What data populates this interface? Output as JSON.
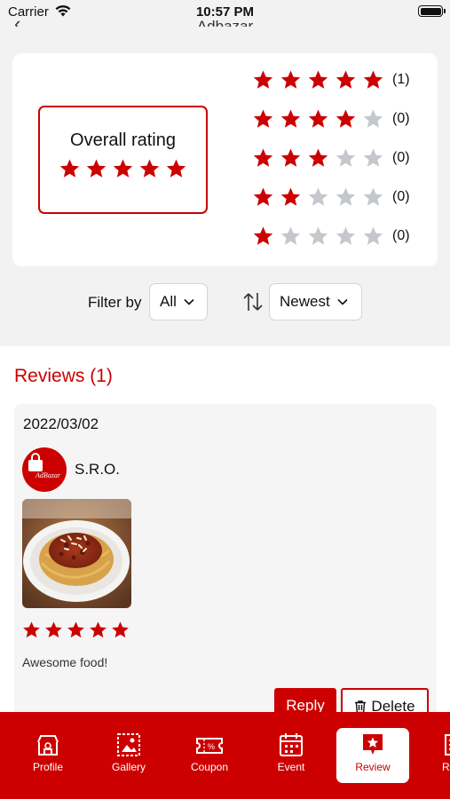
{
  "status_bar": {
    "carrier": "Carrier",
    "time": "10:57 PM"
  },
  "nav": {
    "title": "Adbazar",
    "back_icon": "chevron-left-icon"
  },
  "colors": {
    "accent": "#cc0000",
    "star_empty": "#c4c7cc",
    "background": "#f2f2f2"
  },
  "rating_summary": {
    "overall_label": "Overall rating",
    "overall_stars": 5,
    "breakdown": [
      {
        "stars": 5,
        "count": "(1)"
      },
      {
        "stars": 4,
        "count": "(0)"
      },
      {
        "stars": 3,
        "count": "(0)"
      },
      {
        "stars": 2,
        "count": "(0)"
      },
      {
        "stars": 1,
        "count": "(0)"
      }
    ]
  },
  "filter": {
    "label": "Filter by",
    "selected": "All",
    "sort_icon": "sort-arrows-icon",
    "sort_selected": "Newest"
  },
  "reviews": {
    "title": "Reviews (1)",
    "items": [
      {
        "date": "2022/03/02",
        "reviewer": "S.R.O.",
        "avatar_text": "AdBazar",
        "photo": "spaghetti-bolognese-photo",
        "stars": 5,
        "text": "Awesome food!",
        "reply_label": "Reply",
        "delete_label": "Delete"
      }
    ]
  },
  "tabs": [
    {
      "label": "Profile",
      "icon": "store-icon",
      "active": false
    },
    {
      "label": "Gallery",
      "icon": "gallery-icon",
      "active": false
    },
    {
      "label": "Coupon",
      "icon": "coupon-icon",
      "active": false
    },
    {
      "label": "Event",
      "icon": "calendar-icon",
      "active": false
    },
    {
      "label": "Review",
      "icon": "review-star-icon",
      "active": true
    },
    {
      "label": "Rese",
      "icon": "reservation-icon",
      "active": false
    }
  ]
}
